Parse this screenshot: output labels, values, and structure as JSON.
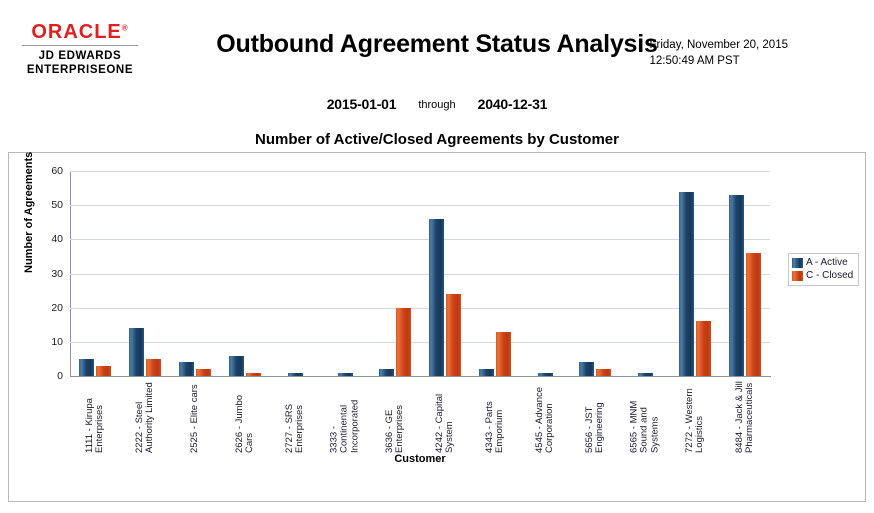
{
  "header": {
    "logo": {
      "brand": "ORACLE",
      "registered": "®",
      "line2": "JD EDWARDS",
      "line3": "ENTERPRISEONE"
    },
    "report_title": "Outbound Agreement Status Analysis",
    "run_date": "Friday, November 20, 2015",
    "run_time": "12:50:49 AM PST"
  },
  "date_range": {
    "from": "2015-01-01",
    "connector": "through",
    "to": "2040-12-31"
  },
  "chart_data": {
    "type": "bar",
    "title": "Number of Active/Closed Agreements by Customer",
    "xlabel": "Customer",
    "ylabel": "Number of Agreements",
    "ylim": [
      0,
      60
    ],
    "yticks": [
      0,
      10,
      20,
      30,
      40,
      50,
      60
    ],
    "grid": true,
    "legend_position": "right",
    "colors": {
      "active": "#1d4468",
      "closed": "#cf4318"
    },
    "categories": [
      "1111 - Kirupa Enterprises",
      "2222 - Steel Authority Limited",
      "2525 - Elite cars",
      "2626 - Jumbo Cars",
      "2727 - SRS Enterprises",
      "3333 - Continental Incorporated",
      "3636 - GE Enterprises",
      "4242 - Capital System",
      "4343 - Parts Emporium",
      "4545 - Advance Corporation",
      "5656 - JST Engineering",
      "6565 - MNM Sound and Systems",
      "7272 - Western Logistics",
      "8484 - Jack & Jill Pharmaceuticals"
    ],
    "series": [
      {
        "name": "A - Active",
        "values": [
          5,
          14,
          4,
          6,
          1,
          1,
          2,
          46,
          2,
          1,
          4,
          1,
          54,
          53
        ]
      },
      {
        "name": "C - Closed",
        "values": [
          3,
          5,
          2,
          1,
          0,
          0,
          20,
          24,
          13,
          0,
          2,
          0,
          16,
          36
        ]
      }
    ]
  }
}
